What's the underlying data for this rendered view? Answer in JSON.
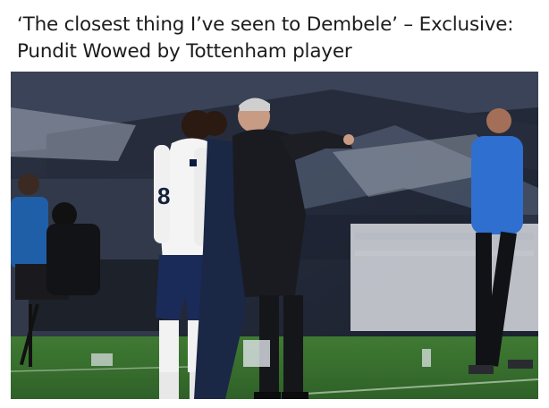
{
  "article": {
    "headline_line1": "‘The closest thing I’ve seen to Dembele’ – Exclusive:",
    "headline_line2": "Pundit Wowed by Tottenham player"
  },
  "photo": {
    "player_shirt_number": "8"
  }
}
